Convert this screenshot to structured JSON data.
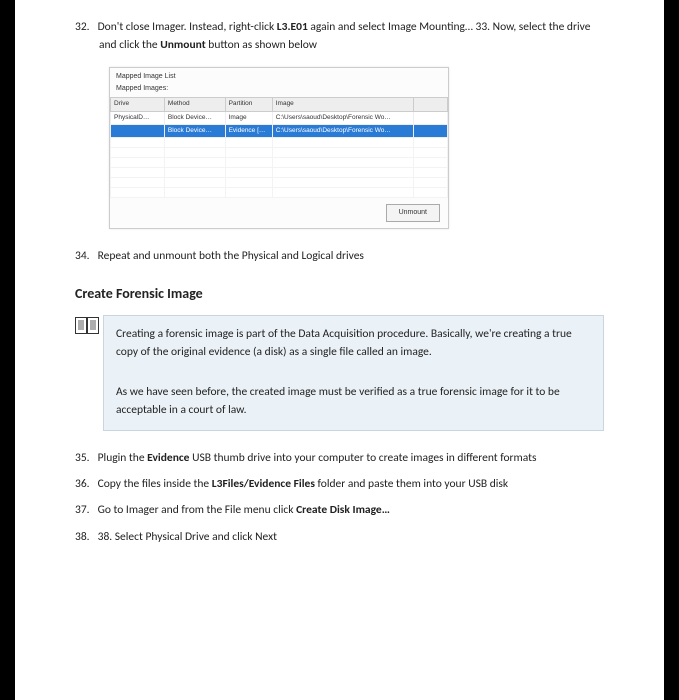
{
  "steps_top": [
    {
      "num": "32.",
      "html": "Don't close Imager. Instead, right-click <b>L3.E01</b> again and select Image Mounting… 33. Now, select the drive and click the <b>Unmount</b> button as shown below"
    }
  ],
  "figure": {
    "title": "Mapped Image List",
    "subtitle": "Mapped Images:",
    "headers": [
      "Drive",
      "Method",
      "Partition",
      "Image",
      ""
    ],
    "rows": [
      [
        "PhysicalD…",
        "Block Device…",
        "Image",
        "C:\\Users\\saoud\\Desktop\\Forensic Wo…",
        ""
      ],
      [
        "",
        "Block Device…",
        "Evidence […",
        "C:\\Users\\saoud\\Desktop\\Forensic Wo…",
        ""
      ]
    ],
    "button": "Unmount"
  },
  "steps_mid": [
    {
      "num": "34.",
      "html": "Repeat and unmount both the Physical and Logical drives"
    }
  ],
  "section_title": "Create Forensic Image",
  "callout": {
    "p1": "Creating a forensic image is part of the Data Acquisition procedure. Basically, we're creating a true copy of the original evidence (a disk) as a single file called an image.",
    "p2": "As we have seen before, the created image must be verified as a true forensic image for it to be acceptable in a court of law."
  },
  "steps_bottom": [
    {
      "num": "35.",
      "html": "Plugin the <b>Evidence</b> USB thumb drive into your computer to create images in different formats"
    },
    {
      "num": "36.",
      "html": "Copy the files inside the <b>L3Files/Evidence Files</b> folder and paste them into your USB disk"
    },
    {
      "num": "37.",
      "html": "Go to Imager and from the File menu click <b>Create Disk Image…</b>"
    },
    {
      "num": "38.",
      "html": "38. Select Physical Drive and click Next"
    }
  ]
}
